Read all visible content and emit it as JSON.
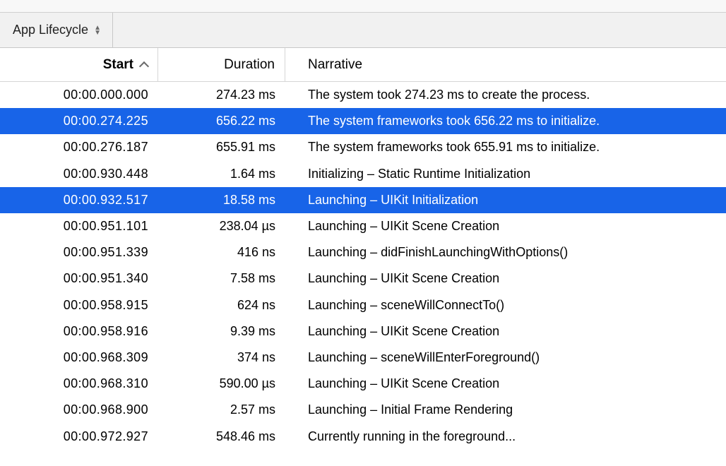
{
  "tab": {
    "label": "App Lifecycle"
  },
  "columns": {
    "start": "Start",
    "duration": "Duration",
    "narrative": "Narrative"
  },
  "rows": [
    {
      "selected": false,
      "start": "00:00.000.000",
      "duration": "274.23 ms",
      "narrative": "The system took 274.23 ms to create the process."
    },
    {
      "selected": true,
      "start": "00:00.274.225",
      "duration": "656.22 ms",
      "narrative": "The system frameworks took 656.22 ms to initialize."
    },
    {
      "selected": false,
      "start": "00:00.276.187",
      "duration": "655.91 ms",
      "narrative": "The system frameworks took 655.91 ms to initialize."
    },
    {
      "selected": false,
      "start": "00:00.930.448",
      "duration": "1.64 ms",
      "narrative": "Initializing – Static Runtime Initialization"
    },
    {
      "selected": true,
      "start": "00:00.932.517",
      "duration": "18.58 ms",
      "narrative": "Launching – UIKit Initialization"
    },
    {
      "selected": false,
      "start": "00:00.951.101",
      "duration": "238.04 µs",
      "narrative": "Launching – UIKit Scene Creation"
    },
    {
      "selected": false,
      "start": "00:00.951.339",
      "duration": "416 ns",
      "narrative": "Launching – didFinishLaunchingWithOptions()"
    },
    {
      "selected": false,
      "start": "00:00.951.340",
      "duration": "7.58 ms",
      "narrative": "Launching – UIKit Scene Creation"
    },
    {
      "selected": false,
      "start": "00:00.958.915",
      "duration": "624 ns",
      "narrative": "Launching – sceneWillConnectTo()"
    },
    {
      "selected": false,
      "start": "00:00.958.916",
      "duration": "9.39 ms",
      "narrative": "Launching – UIKit Scene Creation"
    },
    {
      "selected": false,
      "start": "00:00.968.309",
      "duration": "374 ns",
      "narrative": "Launching – sceneWillEnterForeground()"
    },
    {
      "selected": false,
      "start": "00:00.968.310",
      "duration": "590.00 µs",
      "narrative": "Launching – UIKit Scene Creation"
    },
    {
      "selected": false,
      "start": "00:00.968.900",
      "duration": "2.57 ms",
      "narrative": "Launching – Initial Frame Rendering"
    },
    {
      "selected": false,
      "start": "00:00.972.927",
      "duration": "548.46 ms",
      "narrative": "Currently running in the foreground..."
    }
  ]
}
